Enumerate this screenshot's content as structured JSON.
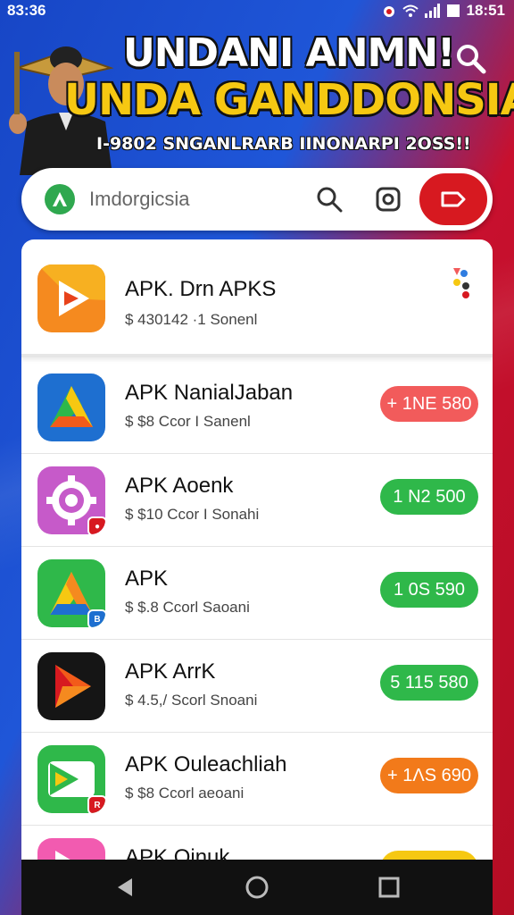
{
  "status": {
    "time": "83:36",
    "clock": "18:51"
  },
  "banner": {
    "headline_1": "UNDANI ANMN!",
    "headline_2": "UNDA GANDDONSIA",
    "subline": "I-9802 SNGANLRARB IINONARPI 2OSS!!"
  },
  "search": {
    "placeholder": "Imdorgicsia",
    "value": "Imdorgicsia"
  },
  "featured_app": {
    "name": "APK. Drn APKS",
    "meta": "$ 430142 ·1 Sonenl",
    "icon": "play-store-icon"
  },
  "apps": [
    {
      "name": "APK NanialJaban",
      "meta": "$ $8 Ccor I Sanenl",
      "price": "+ 1NE 580",
      "color": "#f25b5b",
      "icon": "drive-icon"
    },
    {
      "name": "APK Aoenk",
      "meta": "$ $10 Ccor I Sonahi",
      "price": "1 N2 500",
      "color": "#2fb84a",
      "icon": "gear-icon"
    },
    {
      "name": "APK",
      "meta": "$ $.8 Ccorl Saoani",
      "price": "1 0S 590",
      "color": "#2fb84a",
      "icon": "drive-icon"
    },
    {
      "name": "APK ArrK",
      "meta": "$ 4.5,/ Scorl Snoani",
      "price": "5 115 580",
      "color": "#2fb84a",
      "icon": "play-icon"
    },
    {
      "name": "APK Ouleachliah",
      "meta": "$ $8 Ccorl aeoani",
      "price": "+ 1ΛS 690",
      "color": "#f27a1a",
      "icon": "arrow-icon"
    },
    {
      "name": "APK Oinuk",
      "meta": "",
      "price": "",
      "color": "#f6c812",
      "icon": "play-icon"
    }
  ],
  "colors": {
    "accent_red": "#d71920",
    "green": "#2fb84a",
    "orange": "#f27a1a"
  }
}
